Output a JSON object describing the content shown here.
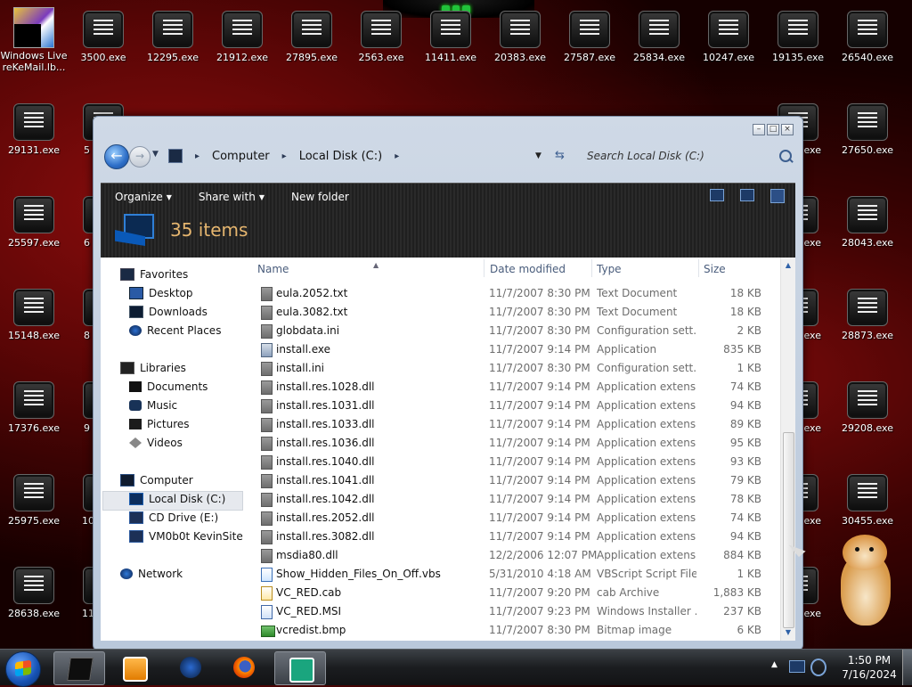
{
  "desktop": {
    "icons": [
      {
        "label": "3500.exe"
      },
      {
        "label": "12295.exe"
      },
      {
        "label": "21912.exe"
      },
      {
        "label": "27895.exe"
      },
      {
        "label": "2563.exe"
      },
      {
        "label": "11411.exe"
      },
      {
        "label": "20383.exe"
      },
      {
        "label": "27587.exe"
      },
      {
        "label": "25834.exe"
      },
      {
        "label": "10247.exe"
      },
      {
        "label": "19135.exe"
      },
      {
        "label": "26540.exe"
      },
      {
        "label": "29131.exe"
      },
      {
        "label": "27650.exe"
      },
      {
        "label": "25597.exe"
      },
      {
        "label": "28043.exe"
      },
      {
        "label": "15148.exe"
      },
      {
        "label": "28873.exe"
      },
      {
        "label": "17376.exe"
      },
      {
        "label": "29208.exe"
      },
      {
        "label": "25975.exe"
      },
      {
        "label": "30455.exe"
      },
      {
        "label": "28638.exe"
      }
    ],
    "partial_labels": {
      "p1": "5",
      "p2": "6",
      "p3": "8",
      "p4": "9",
      "p5": "10",
      "p6": "11",
      "r1": "exe",
      "r2": "exe",
      "r3": "exe",
      "r4": "exe",
      "r5": "exe",
      "r6": "exe",
      "r7": "exe"
    },
    "live_icon_label_line1": "Windows Live",
    "live_icon_label_line2": "reKeMail.lb..."
  },
  "explorer": {
    "breadcrumb": [
      "Computer",
      "Local Disk (C:)"
    ],
    "search_placeholder": "Search Local Disk (C:)",
    "toolbar": {
      "organize": "Organize",
      "share_with": "Share with",
      "new_folder": "New folder"
    },
    "items_count": "35 items",
    "nav": {
      "favorites": "Favorites",
      "desktop": "Desktop",
      "downloads": "Downloads",
      "recent_places": "Recent Places",
      "libraries": "Libraries",
      "documents": "Documents",
      "music": "Music",
      "pictures": "Pictures",
      "videos": "Videos",
      "computer": "Computer",
      "local_disk": "Local Disk (C:)",
      "cd_drive": "CD Drive (E:)",
      "vm_site": "VM0b0t KevinSite",
      "network": "Network"
    },
    "columns": {
      "name": "Name",
      "date_modified": "Date modified",
      "type": "Type",
      "size": "Size"
    },
    "files": [
      {
        "name": "eula.2052.txt",
        "date": "11/7/2007 8:30 PM",
        "type": "Text Document",
        "size": "18 KB"
      },
      {
        "name": "eula.3082.txt",
        "date": "11/7/2007 8:30 PM",
        "type": "Text Document",
        "size": "18 KB"
      },
      {
        "name": "globdata.ini",
        "date": "11/7/2007 8:30 PM",
        "type": "Configuration sett...",
        "size": "2 KB"
      },
      {
        "name": "install.exe",
        "date": "11/7/2007 9:14 PM",
        "type": "Application",
        "size": "835 KB"
      },
      {
        "name": "install.ini",
        "date": "11/7/2007 8:30 PM",
        "type": "Configuration sett...",
        "size": "1 KB"
      },
      {
        "name": "install.res.1028.dll",
        "date": "11/7/2007 9:14 PM",
        "type": "Application extens...",
        "size": "74 KB"
      },
      {
        "name": "install.res.1031.dll",
        "date": "11/7/2007 9:14 PM",
        "type": "Application extens...",
        "size": "94 KB"
      },
      {
        "name": "install.res.1033.dll",
        "date": "11/7/2007 9:14 PM",
        "type": "Application extens...",
        "size": "89 KB"
      },
      {
        "name": "install.res.1036.dll",
        "date": "11/7/2007 9:14 PM",
        "type": "Application extens...",
        "size": "95 KB"
      },
      {
        "name": "install.res.1040.dll",
        "date": "11/7/2007 9:14 PM",
        "type": "Application extens...",
        "size": "93 KB"
      },
      {
        "name": "install.res.1041.dll",
        "date": "11/7/2007 9:14 PM",
        "type": "Application extens...",
        "size": "79 KB"
      },
      {
        "name": "install.res.1042.dll",
        "date": "11/7/2007 9:14 PM",
        "type": "Application extens...",
        "size": "78 KB"
      },
      {
        "name": "install.res.2052.dll",
        "date": "11/7/2007 9:14 PM",
        "type": "Application extens...",
        "size": "74 KB"
      },
      {
        "name": "install.res.3082.dll",
        "date": "11/7/2007 9:14 PM",
        "type": "Application extens...",
        "size": "94 KB"
      },
      {
        "name": "msdia80.dll",
        "date": "12/2/2006 12:07 PM",
        "type": "Application extens...",
        "size": "884 KB"
      },
      {
        "name": "Show_Hidden_Files_On_Off.vbs",
        "date": "5/31/2010 4:18 AM",
        "type": "VBScript Script File",
        "size": "1 KB"
      },
      {
        "name": "VC_RED.cab",
        "date": "11/7/2007 9:20 PM",
        "type": "cab Archive",
        "size": "1,883 KB"
      },
      {
        "name": "VC_RED.MSI",
        "date": "11/7/2007 9:23 PM",
        "type": "Windows Installer ...",
        "size": "237 KB"
      },
      {
        "name": "vcredist.bmp",
        "date": "11/7/2007 8:30 PM",
        "type": "Bitmap image",
        "size": "6 KB"
      }
    ]
  },
  "taskbar": {
    "clock_time": "1:50 PM",
    "clock_date": "7/16/2024"
  }
}
